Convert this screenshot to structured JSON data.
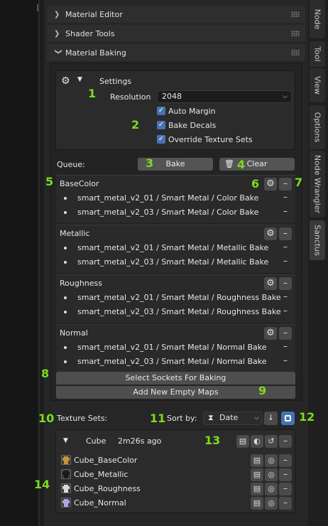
{
  "panels": {
    "material_editor": "Material Editor",
    "shader_tools": "Shader Tools",
    "material_baking": "Material Baking"
  },
  "settings": {
    "title": "Settings",
    "resolution_label": "Resolution",
    "resolution_value": "2048",
    "auto_margin": "Auto Margin",
    "bake_decals": "Bake Decals",
    "override_texture_sets": "Override Texture Sets"
  },
  "queue": {
    "label": "Queue:",
    "bake_button": "Bake",
    "clear_button": "Clear"
  },
  "groups": [
    {
      "name": "BaseColor",
      "items": [
        "smart_metal_v2_01 / Smart Metal / Color Bake",
        "smart_metal_v2_03 / Smart Metal / Color Bake"
      ]
    },
    {
      "name": "Metallic",
      "items": [
        "smart_metal_v2_01 / Smart Metal / Metallic Bake",
        "smart_metal_v2_03 / Smart Metal / Metallic Bake"
      ]
    },
    {
      "name": "Roughness",
      "items": [
        "smart_metal_v2_01 / Smart Metal / Roughness Bake",
        "smart_metal_v2_03 / Smart Metal / Roughness Bake"
      ]
    },
    {
      "name": "Normal",
      "items": [
        "smart_metal_v2_01 / Smart Metal / Normal Bake",
        "smart_metal_v2_03 / Smart Metal / Normal Bake"
      ]
    }
  ],
  "actions": {
    "select_sockets": "Select Sockets For Baking",
    "add_maps": "Add New Empty Maps"
  },
  "texture_sets": {
    "label": "Texture Sets:",
    "sort_label": "Sort by:",
    "sort_value": "Date",
    "set_name": "Cube",
    "set_time": "2m26s ago",
    "maps": [
      {
        "name": "Cube_BaseColor",
        "color": "#c9913a"
      },
      {
        "name": "Cube_Metallic",
        "color": "#1a1a1a"
      },
      {
        "name": "Cube_Roughness",
        "color": "#d8d8d8"
      },
      {
        "name": "Cube_Normal",
        "color": "#a9a6e6"
      }
    ]
  },
  "side_tabs": [
    "Node",
    "Tool",
    "View",
    "Options",
    "Node Wrangler",
    "Sanctus"
  ],
  "annotations": [
    "1",
    "2",
    "3",
    "4",
    "5",
    "6",
    "7",
    "8",
    "9",
    "10",
    "11",
    "12",
    "13",
    "14"
  ],
  "colors": {
    "accent_green": "#7ddc1f",
    "checkbox_blue": "#4772b3"
  }
}
